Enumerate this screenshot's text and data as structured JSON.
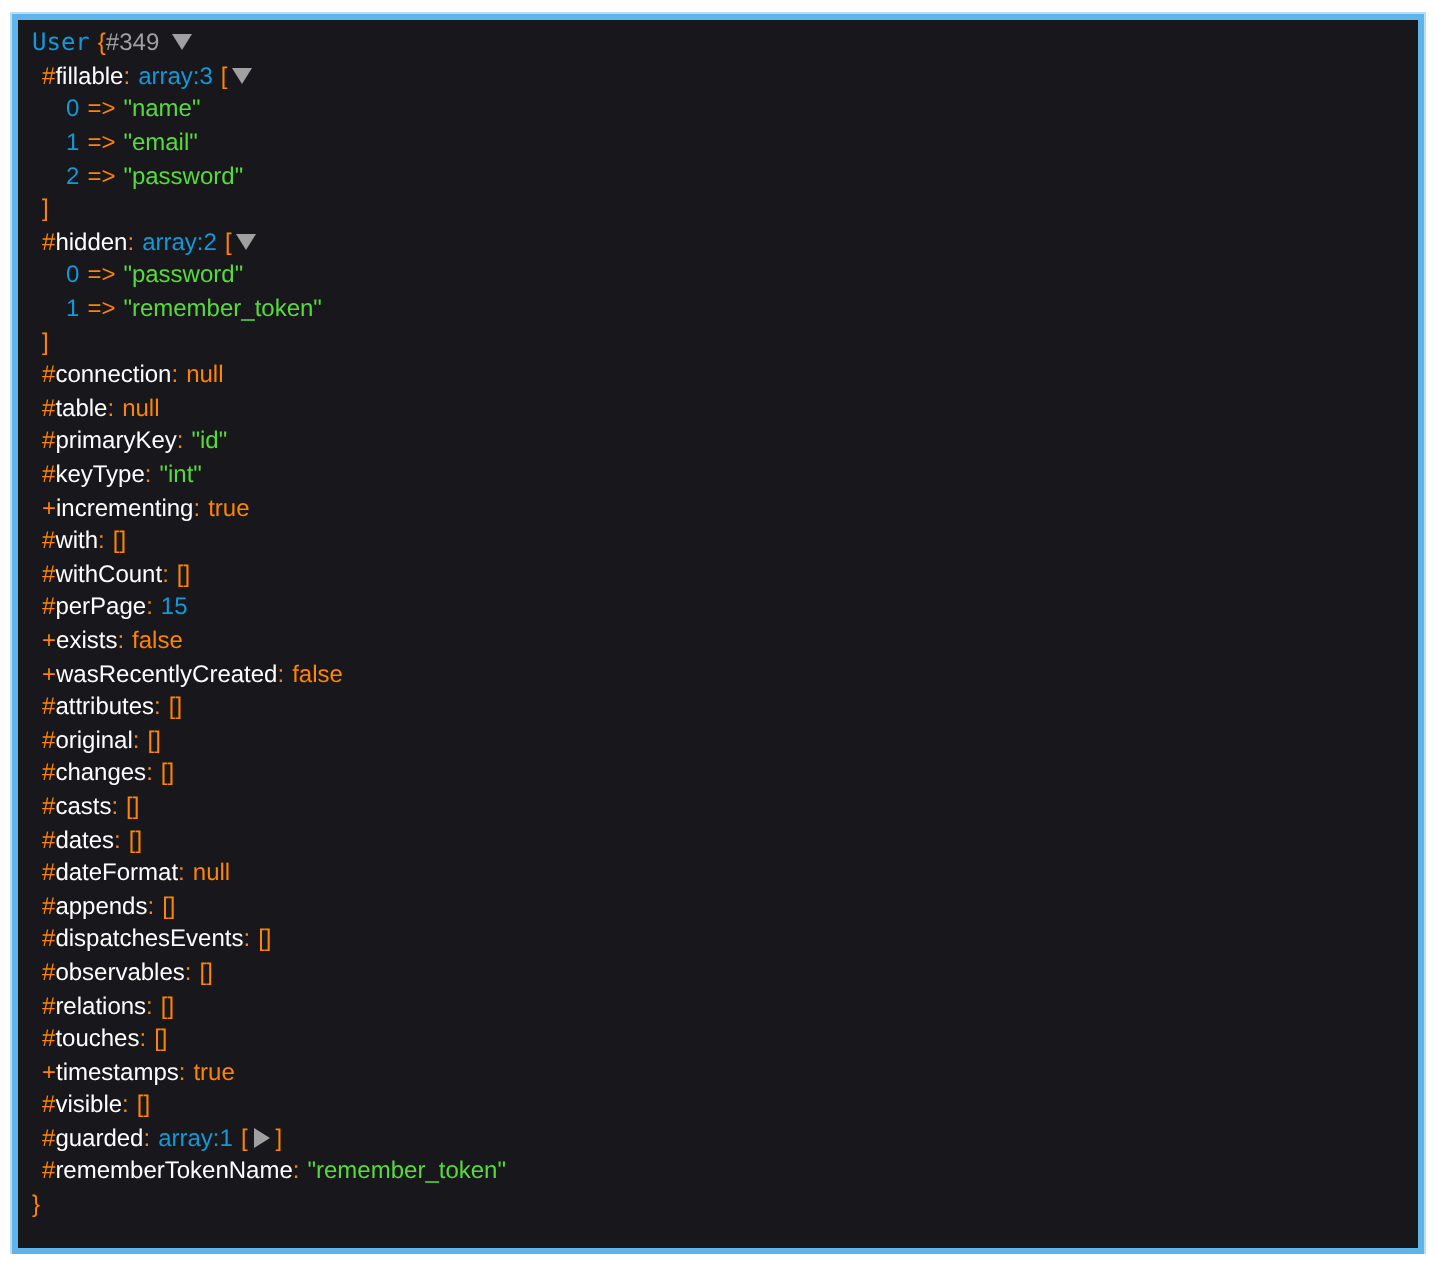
{
  "dump": {
    "class_name": "User",
    "open": "{",
    "object_id": "#349",
    "expanded": true,
    "close": "}",
    "separator": ":",
    "arrow": "=>",
    "properties": [
      {
        "modifier": "#",
        "name": "fillable",
        "kind": "array",
        "label": "array:3",
        "open": "[",
        "close": "]",
        "expanded": true,
        "items": [
          {
            "index": "0",
            "value": "\"name\""
          },
          {
            "index": "1",
            "value": "\"email\""
          },
          {
            "index": "2",
            "value": "\"password\""
          }
        ]
      },
      {
        "modifier": "#",
        "name": "hidden",
        "kind": "array",
        "label": "array:2",
        "open": "[",
        "close": "]",
        "expanded": true,
        "items": [
          {
            "index": "0",
            "value": "\"password\""
          },
          {
            "index": "1",
            "value": "\"remember_token\""
          }
        ]
      },
      {
        "modifier": "#",
        "name": "connection",
        "kind": "constant",
        "value": "null"
      },
      {
        "modifier": "#",
        "name": "table",
        "kind": "constant",
        "value": "null"
      },
      {
        "modifier": "#",
        "name": "primaryKey",
        "kind": "string",
        "value": "\"id\""
      },
      {
        "modifier": "#",
        "name": "keyType",
        "kind": "string",
        "value": "\"int\""
      },
      {
        "modifier": "+",
        "name": "incrementing",
        "kind": "constant",
        "value": "true"
      },
      {
        "modifier": "#",
        "name": "with",
        "kind": "constant",
        "value": "[]"
      },
      {
        "modifier": "#",
        "name": "withCount",
        "kind": "constant",
        "value": "[]"
      },
      {
        "modifier": "#",
        "name": "perPage",
        "kind": "number",
        "value": "15"
      },
      {
        "modifier": "+",
        "name": "exists",
        "kind": "constant",
        "value": "false"
      },
      {
        "modifier": "+",
        "name": "wasRecentlyCreated",
        "kind": "constant",
        "value": "false"
      },
      {
        "modifier": "#",
        "name": "attributes",
        "kind": "constant",
        "value": "[]"
      },
      {
        "modifier": "#",
        "name": "original",
        "kind": "constant",
        "value": "[]"
      },
      {
        "modifier": "#",
        "name": "changes",
        "kind": "constant",
        "value": "[]"
      },
      {
        "modifier": "#",
        "name": "casts",
        "kind": "constant",
        "value": "[]"
      },
      {
        "modifier": "#",
        "name": "dates",
        "kind": "constant",
        "value": "[]"
      },
      {
        "modifier": "#",
        "name": "dateFormat",
        "kind": "constant",
        "value": "null"
      },
      {
        "modifier": "#",
        "name": "appends",
        "kind": "constant",
        "value": "[]"
      },
      {
        "modifier": "#",
        "name": "dispatchesEvents",
        "kind": "constant",
        "value": "[]"
      },
      {
        "modifier": "#",
        "name": "observables",
        "kind": "constant",
        "value": "[]"
      },
      {
        "modifier": "#",
        "name": "relations",
        "kind": "constant",
        "value": "[]"
      },
      {
        "modifier": "#",
        "name": "touches",
        "kind": "constant",
        "value": "[]"
      },
      {
        "modifier": "+",
        "name": "timestamps",
        "kind": "constant",
        "value": "true"
      },
      {
        "modifier": "#",
        "name": "visible",
        "kind": "constant",
        "value": "[]"
      },
      {
        "modifier": "#",
        "name": "guarded",
        "kind": "array",
        "label": "array:1",
        "open": "[",
        "close": "]",
        "expanded": false
      },
      {
        "modifier": "#",
        "name": "rememberTokenName",
        "kind": "string",
        "value": "\"remember_token\""
      }
    ]
  }
}
